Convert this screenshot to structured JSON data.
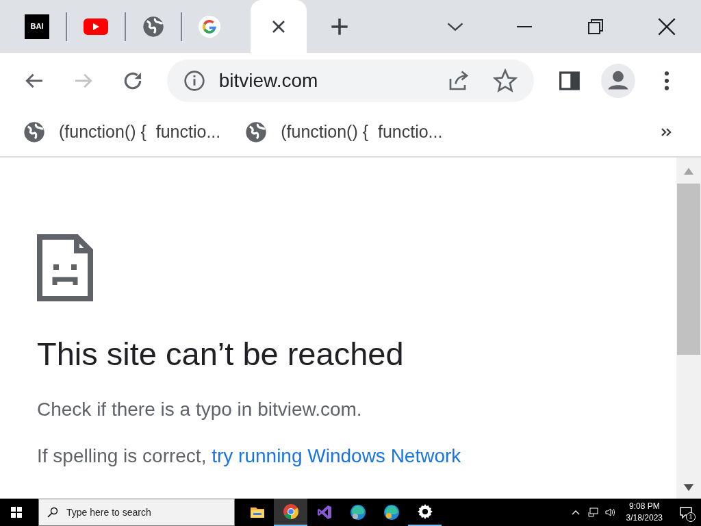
{
  "tabs": [
    {
      "kind": "logo",
      "label": "BAI",
      "selected": false
    },
    {
      "kind": "youtube",
      "selected": false
    },
    {
      "kind": "globe",
      "selected": false
    },
    {
      "kind": "google",
      "selected": false
    },
    {
      "selected": true
    }
  ],
  "toolbar": {
    "forward_disabled": true,
    "url": "bitview.com",
    "bookmarked": false
  },
  "bookmarks": [
    {
      "label": "(function() {  functio..."
    },
    {
      "label": "(function() {  functio..."
    }
  ],
  "page": {
    "title": "This site can’t be reached",
    "lines": [
      {
        "text": "Check if there is a typo in bitview.com."
      },
      {
        "text": "If spelling is correct, ",
        "link": "try running Windows Network"
      }
    ]
  },
  "taskbar": {
    "search_placeholder": "Type here to search",
    "apps": [
      {
        "kind": "folder",
        "active": false
      },
      {
        "kind": "chrome",
        "active": true
      },
      {
        "kind": "studio",
        "active": false
      },
      {
        "kind": "edge",
        "active": false
      },
      {
        "kind": "edge-beta",
        "active": false
      },
      {
        "kind": "gear",
        "active": true
      }
    ],
    "time": "9:08 PM",
    "date": "3/18/2023",
    "notifications": "1"
  }
}
